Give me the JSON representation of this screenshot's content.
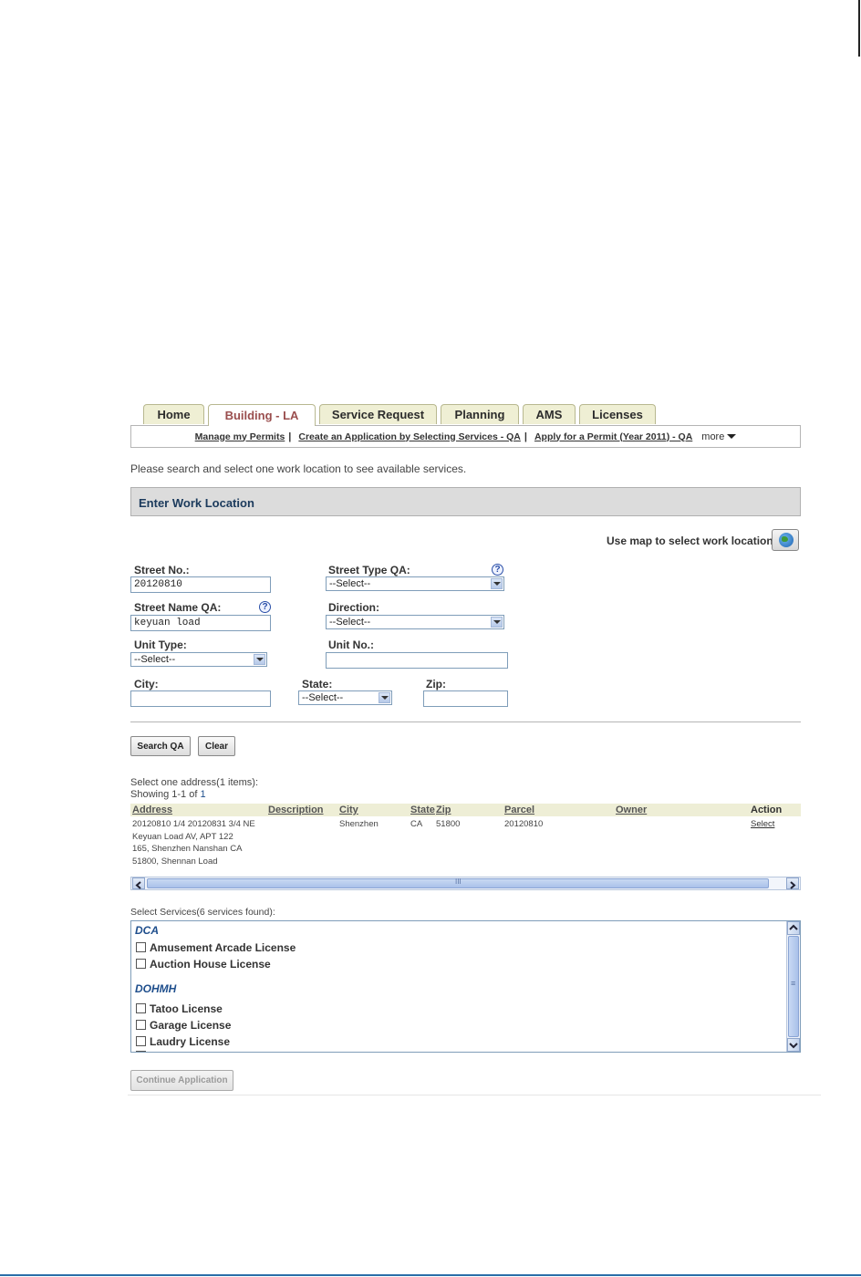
{
  "tabs": [
    "Home",
    "Building - LA",
    "Service Request",
    "Planning",
    "AMS",
    "Licenses"
  ],
  "subnav": {
    "links": [
      "Manage my Permits",
      "Create an Application by Selecting Services - QA",
      "Apply for a Permit (Year 2011) - QA"
    ],
    "separator": "|",
    "more": "more"
  },
  "intro": "Please search and select one work location to see available services.",
  "section_title": "Enter Work Location",
  "map_label": "Use map to select work location:",
  "form": {
    "street_no_label": "Street No.:",
    "street_no_value": "20120810",
    "street_type_label": "Street Type QA:",
    "street_type_value": "--Select--",
    "street_name_label": "Street Name QA:",
    "street_name_value": "keyuan load",
    "direction_label": "Direction:",
    "direction_value": "--Select--",
    "unit_type_label": "Unit Type:",
    "unit_type_value": "--Select--",
    "unit_no_label": "Unit No.:",
    "unit_no_value": "",
    "city_label": "City:",
    "city_value": "",
    "state_label": "State:",
    "state_value": "--Select--",
    "zip_label": "Zip:",
    "zip_value": "",
    "help": "?"
  },
  "buttons": {
    "search": "Search QA",
    "clear": "Clear",
    "continue": "Continue Application"
  },
  "results": {
    "heading": "Select one address(1 items):",
    "showing_prefix": "Showing 1-1 of ",
    "showing_total": "1",
    "headers": [
      "Address",
      "Description",
      "City",
      "State",
      "Zip",
      "Parcel",
      "Owner",
      "Action"
    ],
    "row": {
      "address": [
        "20120810 1/4 20120831 3/4 NE",
        "Keyuan Load AV, APT 122",
        "165, Shenzhen Nanshan CA",
        "51800, Shennan Load"
      ],
      "city": "Shenzhen",
      "state": "CA",
      "zip": "51800",
      "parcel": "20120810",
      "action": "Select"
    },
    "hscroll_grip": "III"
  },
  "services": {
    "heading": "Select Services(6 services found):",
    "groups": [
      {
        "name": "DCA",
        "items": [
          "Amusement Arcade License",
          "Auction House License"
        ]
      },
      {
        "name": "DOHMH",
        "items": [
          "Tatoo License",
          "Garage License",
          "Laudry License"
        ]
      }
    ],
    "vscroll_grip": "≡"
  }
}
